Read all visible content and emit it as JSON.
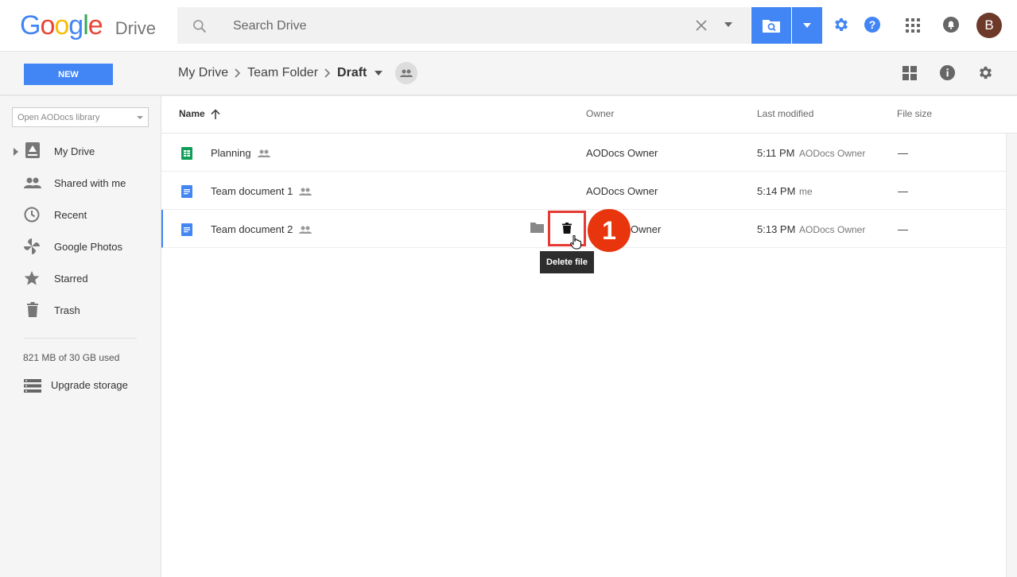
{
  "app": {
    "logo_text": "Google",
    "product": "Drive"
  },
  "colors": {
    "accent": "#4285f4",
    "annotation": "#e53935",
    "badge": "#e8350e"
  },
  "search": {
    "placeholder": "Search Drive"
  },
  "user": {
    "initial": "B"
  },
  "toolbar": {
    "new_label": "NEW"
  },
  "breadcrumb": {
    "items": [
      "My Drive",
      "Team Folder",
      "Draft"
    ]
  },
  "sidebar": {
    "library_placeholder": "Open AODocs library",
    "items": [
      {
        "label": "My Drive",
        "icon": "drive-icon"
      },
      {
        "label": "Shared with me",
        "icon": "people-icon"
      },
      {
        "label": "Recent",
        "icon": "clock-icon"
      },
      {
        "label": "Google Photos",
        "icon": "photos-icon"
      },
      {
        "label": "Starred",
        "icon": "star-icon"
      },
      {
        "label": "Trash",
        "icon": "trash-icon"
      }
    ],
    "storage": "821 MB of 30 GB used",
    "upgrade": "Upgrade storage"
  },
  "list": {
    "columns": {
      "name": "Name",
      "owner": "Owner",
      "modified": "Last modified",
      "size": "File size"
    },
    "rows": [
      {
        "name": "Planning",
        "type": "sheet",
        "owner": "AODocs Owner",
        "time": "5:11 PM",
        "by": "AODocs Owner",
        "size": "—"
      },
      {
        "name": "Team document 1",
        "type": "doc",
        "owner": "AODocs Owner",
        "time": "5:14 PM",
        "by": "me",
        "size": "—"
      },
      {
        "name": "Team document 2",
        "type": "doc",
        "owner": "Owner",
        "time": "5:13 PM",
        "by": "AODocs Owner",
        "size": "—"
      }
    ]
  },
  "annotation": {
    "step": "1",
    "tooltip": "Delete file"
  }
}
